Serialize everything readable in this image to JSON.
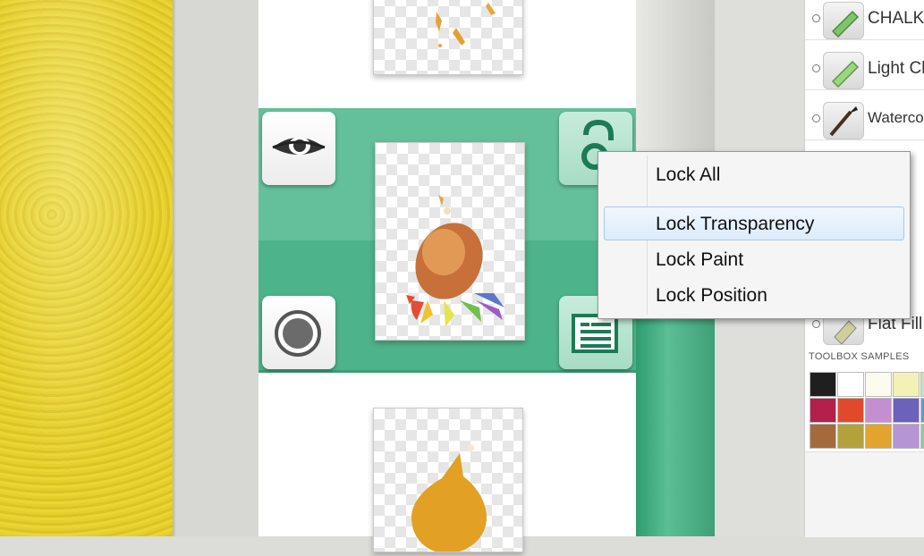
{
  "lock_menu": {
    "items": [
      "Lock All",
      "Lock Transparency",
      "Lock Paint",
      "Lock Position"
    ],
    "highlighted": "Lock Transparency"
  },
  "tools": [
    {
      "label": "CHALK-",
      "icon": "chalk-icon"
    },
    {
      "label": "Light Cl",
      "icon": "chalk-icon"
    },
    {
      "label": "Waterco",
      "icon": "brush-icon"
    },
    {
      "label": "Flat Fill",
      "icon": "fill-icon"
    }
  ],
  "samples_title": "TOOLBOX SAMPLES",
  "swatches": [
    "#1f1f1f",
    "#ffffff",
    "#fbfbee",
    "#f3f1b6",
    "#c5e3b9",
    "#b3204c",
    "#e04a2b",
    "#c48ed0",
    "#6c62bb",
    "#6a9ac9",
    "#a56a3c",
    "#b3a23c",
    "#e2a42e",
    "#b794d4",
    "#8fc9a1"
  ],
  "colors": {
    "selected_layer": "#63c09b",
    "canvas": "#e2ca2a",
    "menu_highlight": "#dcebfb"
  }
}
